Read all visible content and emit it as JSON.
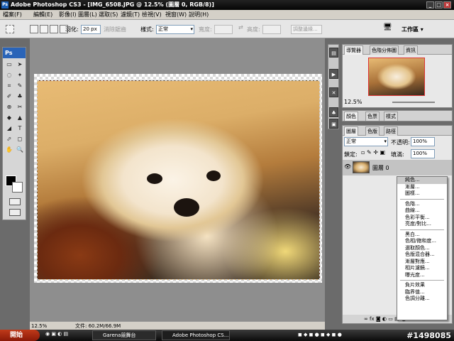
{
  "window": {
    "title": "Adobe Photoshop CS3 - [IMG_6508.JPG @ 12.5% (圖層 0, RGB/8)]",
    "min": "_",
    "max": "□",
    "close": "×"
  },
  "menu": [
    "檔案(F)",
    "編輯(E)",
    "影像(I)",
    "圖層(L)",
    "選取(S)",
    "濾鏡(T)",
    "檢視(V)",
    "視窗(W)",
    "說明(H)"
  ],
  "options": {
    "feather_label": "羽化:",
    "feather_value": "20 px",
    "antialias": "消除鋸齒",
    "style_label": "樣式:",
    "style_value": "正常",
    "width_label": "寬度:",
    "height_label": "高度:",
    "refine": "調整邊緣...",
    "workspace": "工作區 ▾"
  },
  "toolbox": {
    "logo": "Ps",
    "tools": [
      "▭",
      "➤",
      "◌",
      "✦",
      "⌗",
      "✎",
      "✐",
      "♣",
      "⊕",
      "✂",
      "◆",
      "▲",
      "◢",
      "T",
      "⬀",
      "◻",
      "✋",
      "🔍"
    ]
  },
  "document": {
    "zoom": "12.5%",
    "file_info": "文件: 60.2M/66.9M"
  },
  "navigator": {
    "tabs": [
      "導覽器",
      "色階分佈圖",
      "資訊"
    ],
    "zoom": "12.5%"
  },
  "color_panel": {
    "tabs": [
      "顏色",
      "色票",
      "樣式"
    ]
  },
  "layers_panel": {
    "tabs": [
      "圖層",
      "色版",
      "路徑"
    ],
    "blend_mode": "正常",
    "opacity_label": "不透明:",
    "opacity_value": "100%",
    "lock_label": "鎖定:",
    "fill_label": "填滿:",
    "fill_value": "100%",
    "layer_name": "圖層 0"
  },
  "context_menu": {
    "groups": [
      [
        "純色...",
        "漸層...",
        "圖樣..."
      ],
      [
        "色階...",
        "曲線...",
        "色彩平衡...",
        "亮度/對比..."
      ],
      [
        "黑白...",
        "色相/飽和度...",
        "選取顏色...",
        "色版混合器...",
        "漸層對應...",
        "相片濾鏡...",
        "曝光度..."
      ],
      [
        "負片效果",
        "臨界值...",
        "色調分離..."
      ]
    ],
    "highlighted": "純色..."
  },
  "taskbar": {
    "start": "開始",
    "tasks": [
      "Garena競舞台",
      "Adobe Photoshop CS..."
    ]
  },
  "watermark": "#1498085"
}
